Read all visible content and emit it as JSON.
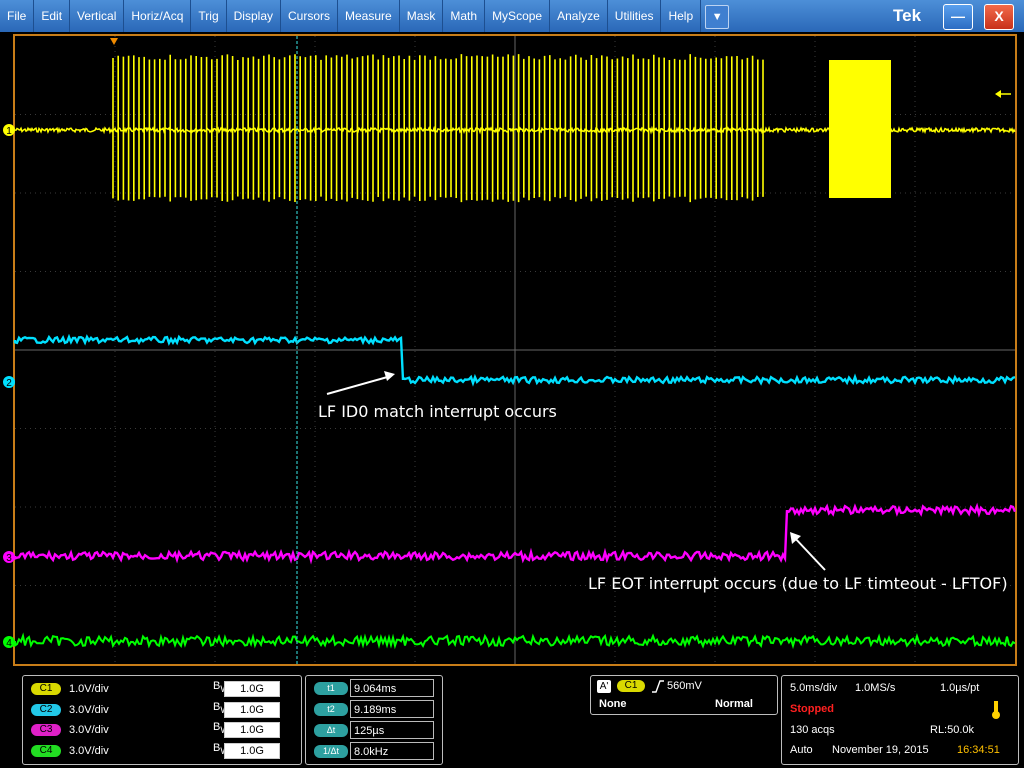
{
  "menu": {
    "items": [
      "File",
      "Edit",
      "Vertical",
      "Horiz/Acq",
      "Trig",
      "Display",
      "Cursors",
      "Measure",
      "Mask",
      "Math",
      "MyScope",
      "Analyze",
      "Utilities",
      "Help"
    ],
    "dropdown_icon": "chevron-down",
    "brand": "Tek",
    "minimize_label": "—",
    "close_label": "X"
  },
  "channels": [
    {
      "id": "C1",
      "marker": "1",
      "scale": "1.0V/div",
      "bw": "1.0G",
      "color": "#ffff00",
      "pill_color": "#d9d900"
    },
    {
      "id": "C2",
      "marker": "2",
      "scale": "3.0V/div",
      "bw": "1.0G",
      "color": "#00e0ff",
      "pill_color": "#22c8e8"
    },
    {
      "id": "C3",
      "marker": "3",
      "scale": "3.0V/div",
      "bw": "1.0G",
      "color": "#ff00ff",
      "pill_color": "#e020c8"
    },
    {
      "id": "C4",
      "marker": "4",
      "scale": "3.0V/div",
      "bw": "1.0G",
      "color": "#00ff00",
      "pill_color": "#22dd22"
    }
  ],
  "bw_prefix": "B",
  "bw_sub": "W",
  "annotations": {
    "id0": "LF ID0 match interrupt occurs",
    "eot": "LF EOT interrupt occurs (due to LF timteout - LFTOF)"
  },
  "cursors": [
    {
      "label": "t1",
      "value": "9.064ms"
    },
    {
      "label": "t2",
      "value": "9.189ms"
    },
    {
      "label": "Δt",
      "value": "125µs"
    },
    {
      "label": "1/Δt",
      "value": "8.0kHz"
    }
  ],
  "trigger": {
    "mode_badge": "A'",
    "source": "C1",
    "slope_icon": "rising-edge-icon",
    "level": "560mV",
    "coupling": "None",
    "mode": "Normal"
  },
  "acquisition": {
    "timebase": "5.0ms/div",
    "sample_rate": "1.0MS/s",
    "resolution": "1.0µs/pt",
    "state": "Stopped",
    "acqs": "130 acqs",
    "record_length": "RL:50.0k",
    "run_mode": "Auto",
    "date": "November 19, 2015",
    "time": "16:34:51",
    "state_color": "#ff2020",
    "time_color": "#ffc000"
  }
}
